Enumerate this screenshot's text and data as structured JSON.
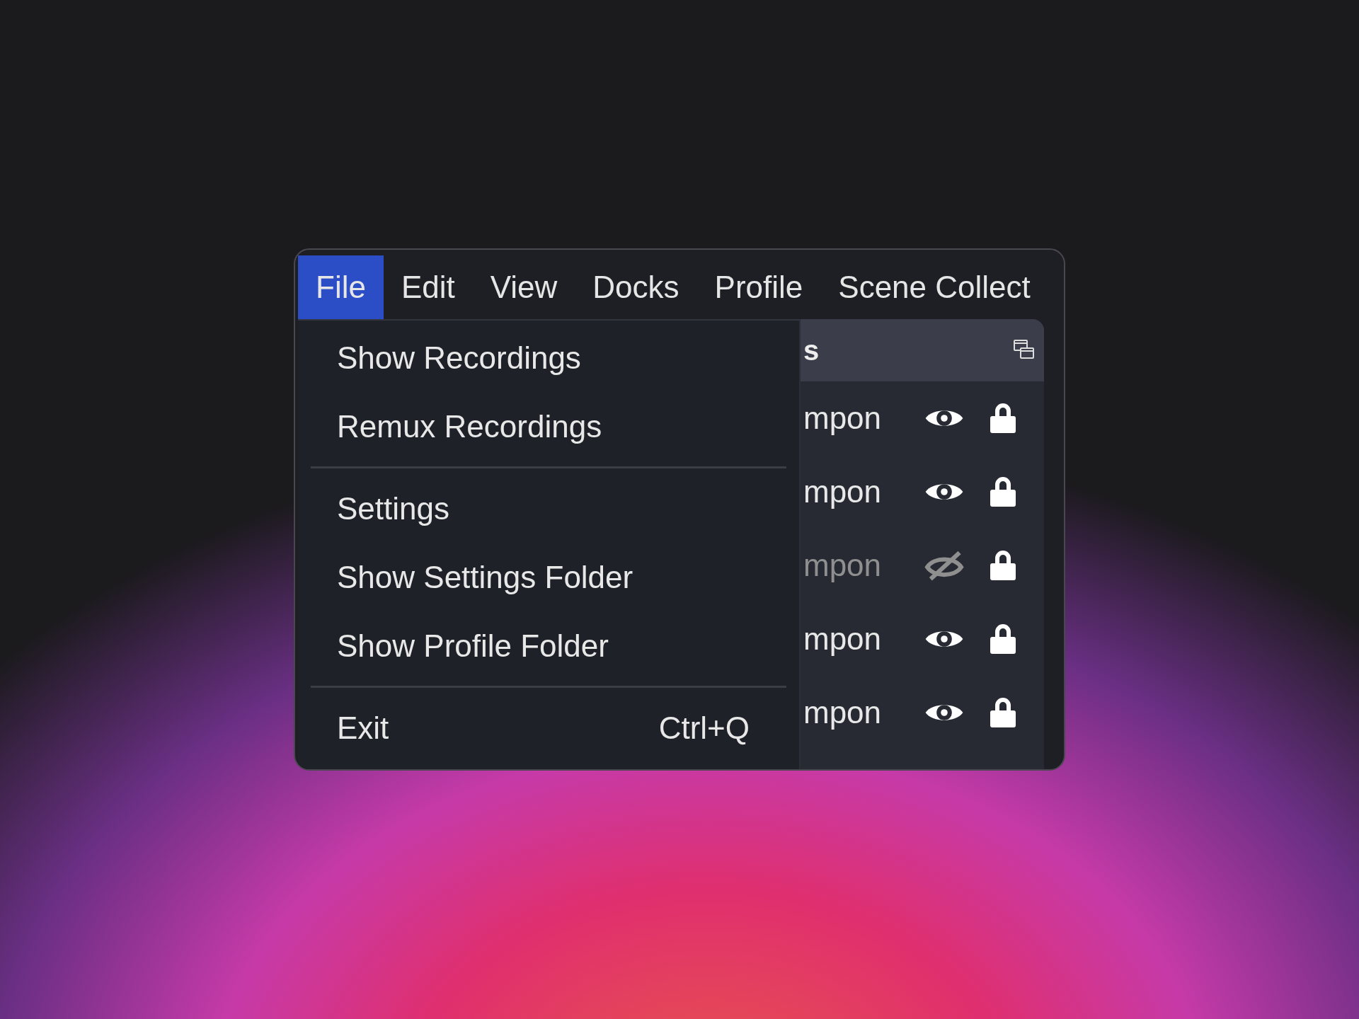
{
  "menu_bar": [
    {
      "label": "File",
      "selected": true
    },
    {
      "label": "Edit",
      "selected": false
    },
    {
      "label": "View",
      "selected": false
    },
    {
      "label": "Docks",
      "selected": false
    },
    {
      "label": "Profile",
      "selected": false
    },
    {
      "label": "Scene Collect",
      "selected": false
    }
  ],
  "file_menu": [
    {
      "kind": "item",
      "label": "Show Recordings"
    },
    {
      "kind": "item",
      "label": "Remux Recordings"
    },
    {
      "kind": "separator"
    },
    {
      "kind": "item",
      "label": "Settings"
    },
    {
      "kind": "item",
      "label": "Show Settings Folder"
    },
    {
      "kind": "item",
      "label": "Show Profile Folder"
    },
    {
      "kind": "separator"
    },
    {
      "kind": "item",
      "label": "Exit",
      "shortcut": "Ctrl+Q"
    }
  ],
  "sources_dock": {
    "title": "s",
    "rows": [
      {
        "name": "mpon",
        "visible": true,
        "locked": true
      },
      {
        "name": "mpon",
        "visible": true,
        "locked": true
      },
      {
        "name": "mpon",
        "visible": false,
        "locked": true
      },
      {
        "name": "mpon",
        "visible": true,
        "locked": true
      },
      {
        "name": "mpon",
        "visible": true,
        "locked": true
      }
    ]
  }
}
